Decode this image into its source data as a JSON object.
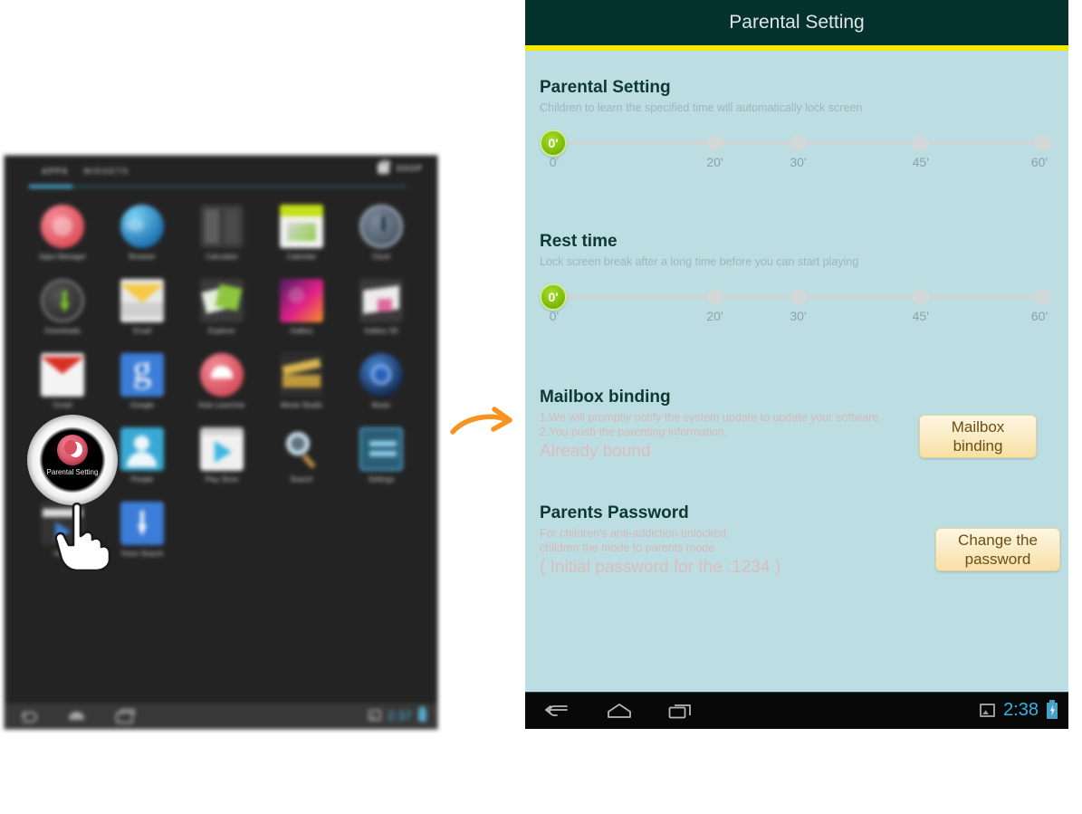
{
  "tablet": {
    "tabs": [
      "APPS",
      "WIDGETS"
    ],
    "shop_label": "SHOP",
    "apps": [
      {
        "label": "Apps Manager",
        "icon": "apps-manager-icon",
        "cls": "ic-appmgr"
      },
      {
        "label": "Browser",
        "icon": "browser-icon",
        "cls": "ic-browser"
      },
      {
        "label": "Calculator",
        "icon": "calculator-icon",
        "cls": "ic-calc"
      },
      {
        "label": "Calendar",
        "icon": "calendar-icon",
        "cls": "ic-cal"
      },
      {
        "label": "Clock",
        "icon": "clock-icon",
        "cls": "ic-clock"
      },
      {
        "label": "Downloads",
        "icon": "downloads-icon",
        "cls": "ic-dl"
      },
      {
        "label": "Email",
        "icon": "email-icon",
        "cls": "ic-email"
      },
      {
        "label": "Explorer",
        "icon": "explorer-icon",
        "cls": "ic-gallery"
      },
      {
        "label": "Gallery",
        "icon": "gallery-icon",
        "cls": "ic-gal2"
      },
      {
        "label": "Gallery 3D",
        "icon": "gallery-3d-icon",
        "cls": "ic-gal3"
      },
      {
        "label": "Gmail",
        "icon": "gmail-icon",
        "cls": "ic-gmail"
      },
      {
        "label": "Google",
        "icon": "google-icon",
        "cls": "ic-google"
      },
      {
        "label": "Kids Launcher",
        "icon": "kids-launcher-icon",
        "cls": "ic-kids"
      },
      {
        "label": "Movie Studio",
        "icon": "movie-studio-icon",
        "cls": "ic-movie"
      },
      {
        "label": "Music",
        "icon": "music-icon",
        "cls": "ic-music"
      },
      {
        "label": "Parental Setting",
        "icon": "parental-setting-icon",
        "cls": "ic-kids"
      },
      {
        "label": "People",
        "icon": "people-icon",
        "cls": "ic-people"
      },
      {
        "label": "Play Store",
        "icon": "play-store-icon",
        "cls": "ic-play"
      },
      {
        "label": "Search",
        "icon": "search-icon",
        "cls": "ic-search"
      },
      {
        "label": "Settings",
        "icon": "settings-icon",
        "cls": "ic-settings"
      },
      {
        "label": "Video",
        "icon": "video-icon",
        "cls": "ic-video"
      },
      {
        "label": "Voice Search",
        "icon": "voice-search-icon",
        "cls": "ic-voice"
      }
    ],
    "highlighted_app": "Parental Setting",
    "statusbar": {
      "time": "2:37"
    }
  },
  "device": {
    "header": {
      "title": "Parental Setting",
      "accent_color": "#f4ea00",
      "background_color": "#05312f"
    },
    "body_color": "#bcdee3",
    "sections": [
      {
        "title": "Parental Setting",
        "desc": "Children to learn the specified time will automatically lock screen",
        "slider": {
          "value": "0'",
          "ticks": [
            "0'",
            "20'",
            "30'",
            "45'",
            "60'"
          ],
          "positions": [
            0,
            33,
            50,
            75,
            100
          ]
        }
      },
      {
        "title": "Rest time",
        "desc": "Lock screen break after a long time before you can start playing",
        "slider": {
          "value": "0'",
          "ticks": [
            "0'",
            "20'",
            "30'",
            "45'",
            "60'"
          ],
          "positions": [
            0,
            33,
            50,
            75,
            100
          ]
        }
      }
    ],
    "mailbox": {
      "title": "Mailbox binding",
      "line1": "1.We will promptly notify the system update to update your software.",
      "line2": "2.You push the parenting information.",
      "status": "Already bound",
      "button": "Mailbox binding"
    },
    "password": {
      "title": "Parents Password",
      "line1": "For children's anti-addiction unlocked.",
      "line2": "children the mode to parents mode",
      "note": "( Initial password for the :1234 )",
      "button": "Change the password"
    },
    "navbar": {
      "back_icon": "back-icon",
      "home_icon": "home-icon",
      "recents_icon": "recents-icon",
      "screenshot_icon": "screenshot-icon",
      "time": "2:38",
      "battery_icon": "battery-charging-icon",
      "time_color": "#33b5e5"
    }
  },
  "annotation": {
    "arrow_icon": "curved-arrow-icon",
    "arrow_color": "#f7931e",
    "hand_icon": "pointing-hand-cursor-icon"
  }
}
